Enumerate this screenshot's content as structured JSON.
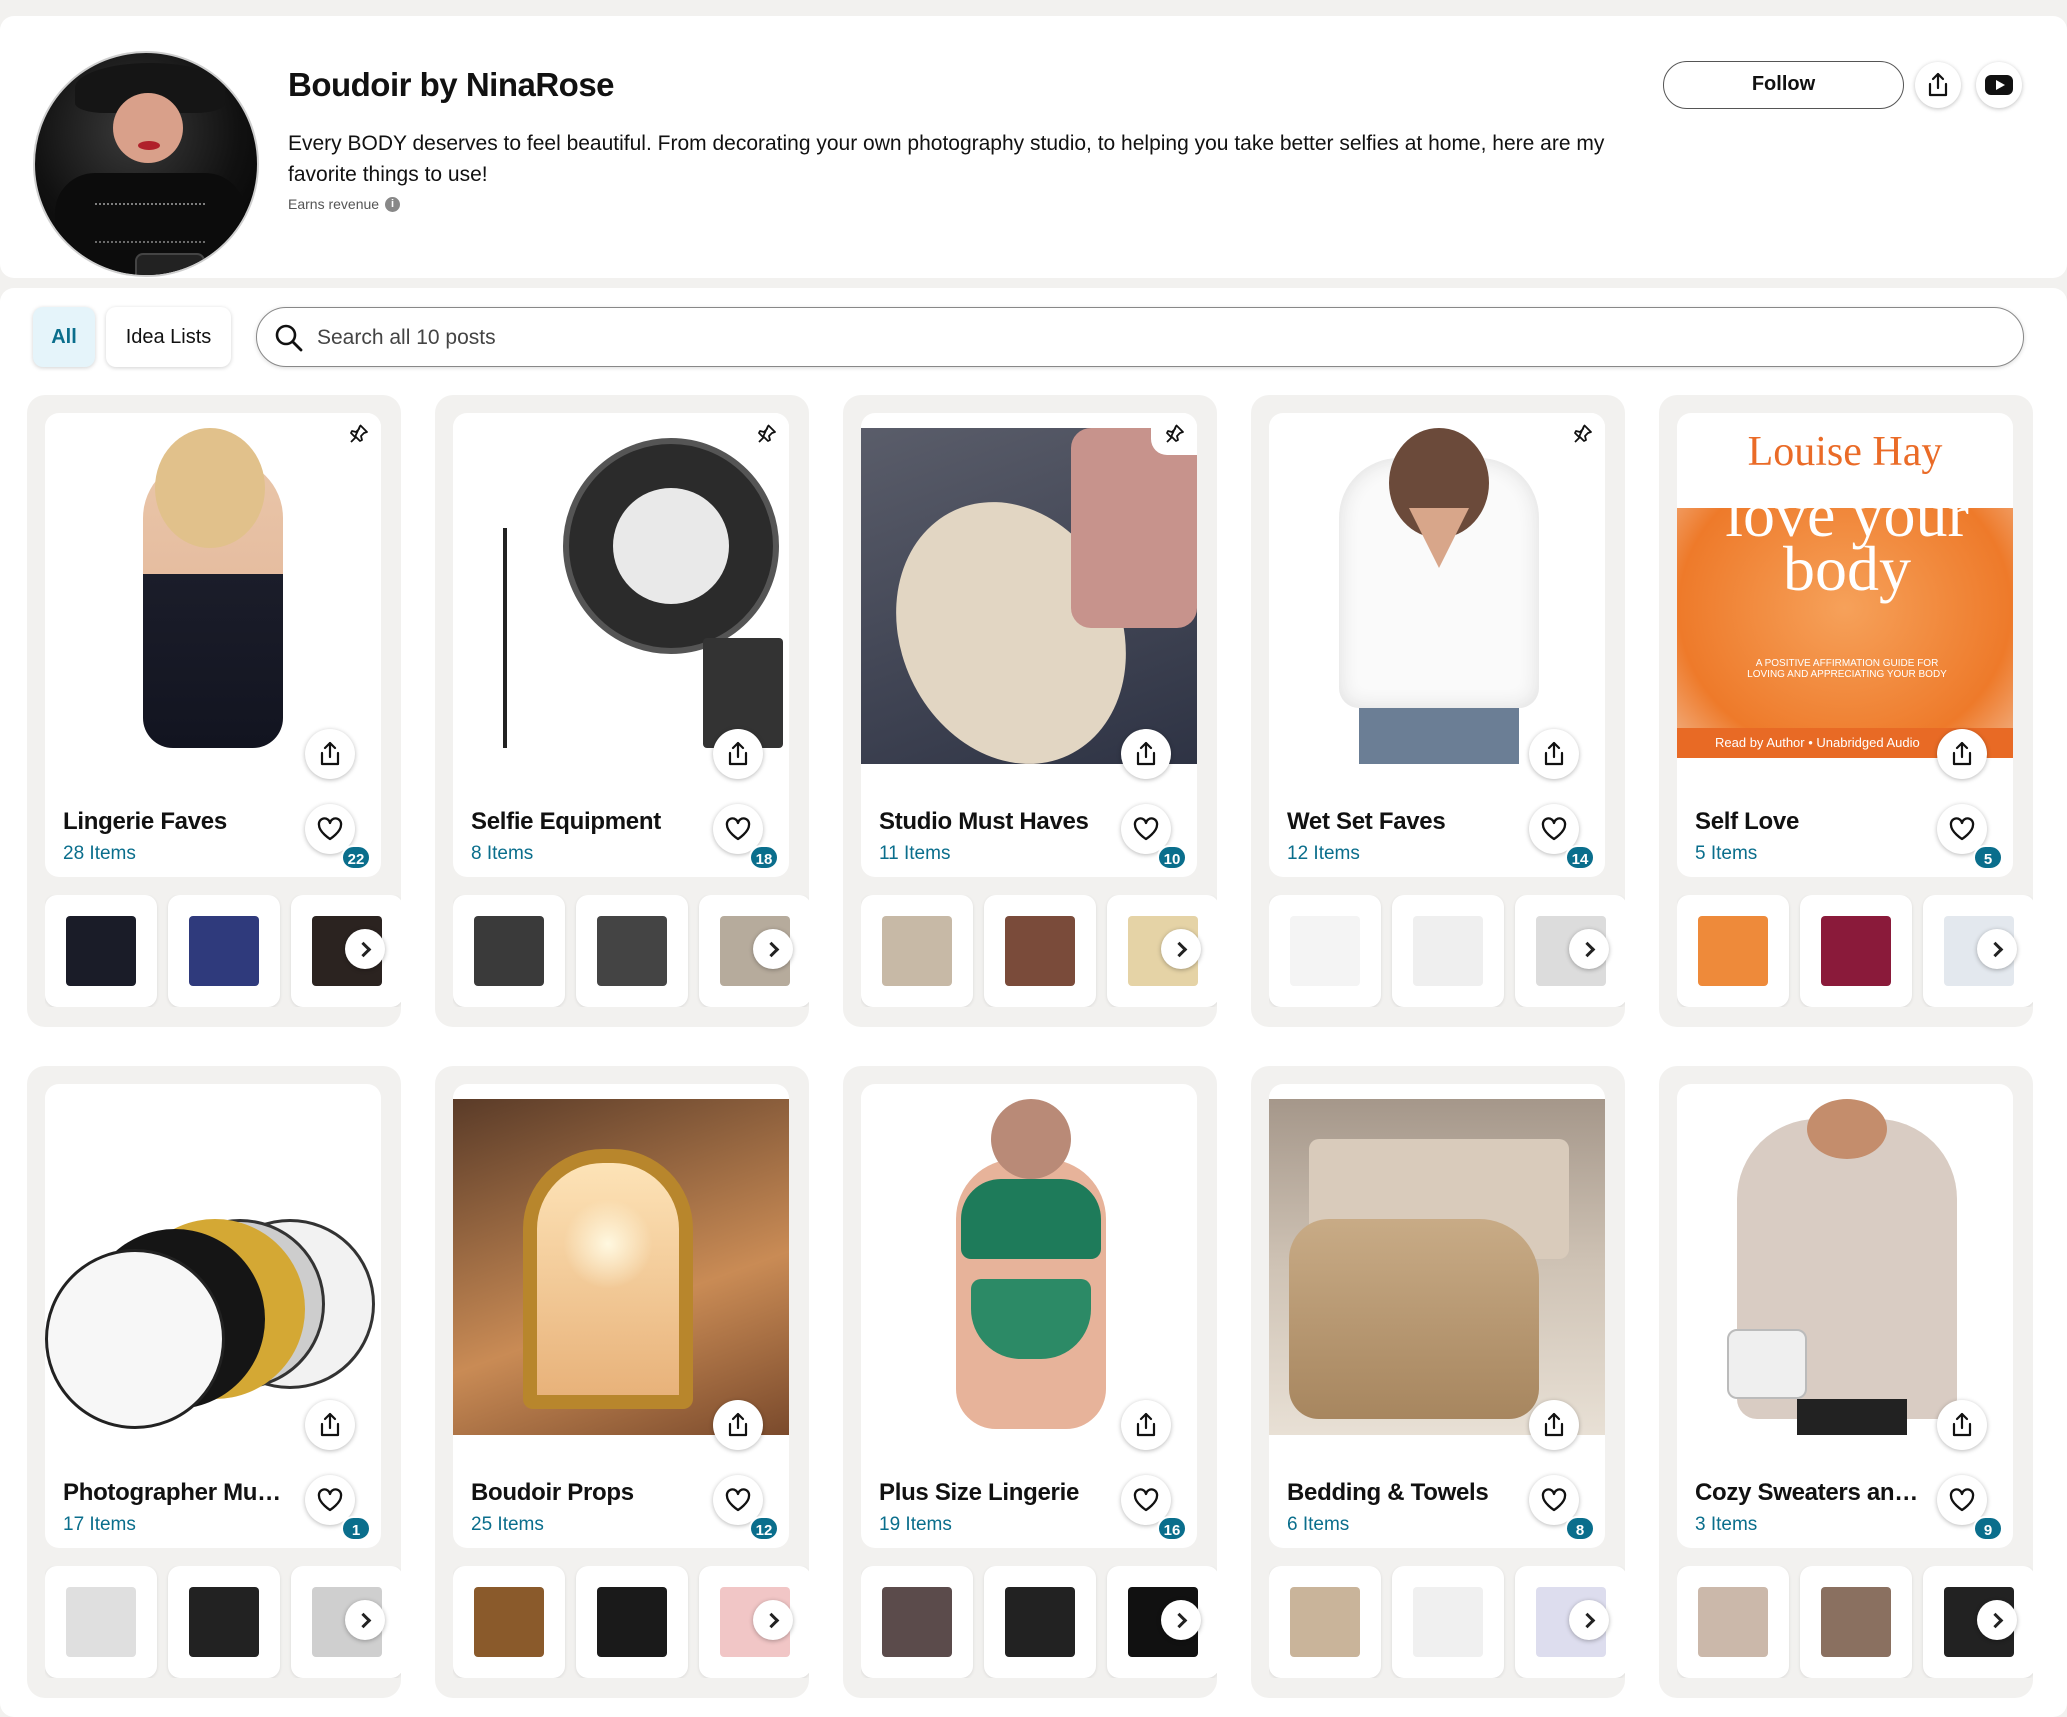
{
  "profile": {
    "name": "Boudoir by NinaRose",
    "bio": "Every BODY deserves to feel beautiful. From decorating your own photography studio, to helping you take better selfies at home, here are my favorite things to use!",
    "earns_label": "Earns revenue",
    "follow_label": "Follow"
  },
  "tabs": {
    "all": "All",
    "ideas": "Idea Lists"
  },
  "search": {
    "placeholder": "Search all 10 posts"
  },
  "colors": {
    "accent": "#0a6e8c",
    "tab_bg": "#e5f4fa",
    "card_bg": "#f2f1ef"
  },
  "lists": [
    {
      "title": "Lingerie Faves",
      "count": "28 Items",
      "likes": "22",
      "pinned": true
    },
    {
      "title": "Selfie Equipment",
      "count": "8 Items",
      "likes": "18",
      "pinned": true
    },
    {
      "title": "Studio Must Haves",
      "count": "11 Items",
      "likes": "10",
      "pinned": true
    },
    {
      "title": "Wet Set Faves",
      "count": "12 Items",
      "likes": "14",
      "pinned": true
    },
    {
      "title": "Self Love",
      "count": "5 Items",
      "likes": "5",
      "pinned": false
    },
    {
      "title": "Photographer Must Haves",
      "count": "17 Items",
      "likes": "1",
      "pinned": false
    },
    {
      "title": "Boudoir Props",
      "count": "25 Items",
      "likes": "12",
      "pinned": false
    },
    {
      "title": "Plus Size Lingerie",
      "count": "19 Items",
      "likes": "16",
      "pinned": false
    },
    {
      "title": "Bedding & Towels",
      "count": "6 Items",
      "likes": "8",
      "pinned": false
    },
    {
      "title": "Cozy Sweaters and Cardigans",
      "count": "3 Items",
      "likes": "9",
      "pinned": false
    }
  ],
  "book": {
    "author": "Louise Hay",
    "title": "love your body",
    "subtitle": "A POSITIVE AFFIRMATION GUIDE FOR LOVING AND APPRECIATING YOUR BODY",
    "strip": "Read by Author • Unabridged Audio"
  },
  "icons": {
    "share": "share-icon",
    "heart": "heart-icon",
    "pin": "pin-icon",
    "next": "chevron-right-icon",
    "search": "search-icon",
    "youtube": "youtube-icon"
  }
}
